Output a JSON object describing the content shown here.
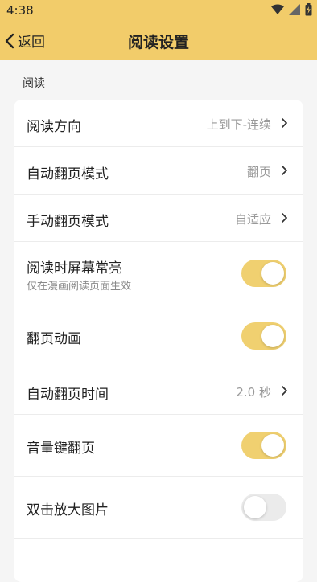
{
  "status_bar": {
    "time": "4:38"
  },
  "nav": {
    "back_label": "返回",
    "title": "阅读设置"
  },
  "section": {
    "title": "阅读"
  },
  "rows": [
    {
      "label": "阅读方向",
      "value": "上到下-连续"
    },
    {
      "label": "自动翻页模式",
      "value": "翻页"
    },
    {
      "label": "手动翻页模式",
      "value": "自适应"
    },
    {
      "label": "阅读时屏幕常亮",
      "sub": "仅在漫画阅读页面生效",
      "toggle": true
    },
    {
      "label": "翻页动画",
      "toggle": true
    },
    {
      "label": "自动翻页时间",
      "value": "2.0 秒"
    },
    {
      "label": "音量键翻页",
      "toggle": true
    },
    {
      "label": "双击放大图片",
      "toggle": false
    }
  ],
  "colors": {
    "header": "#f2cc6a",
    "toggle_on": "#f0d070",
    "toggle_off": "#ebebeb"
  },
  "icons": [
    "wifi-icon",
    "signal-icon",
    "battery-icon",
    "chevron-left-icon",
    "chevron-right-icon"
  ]
}
